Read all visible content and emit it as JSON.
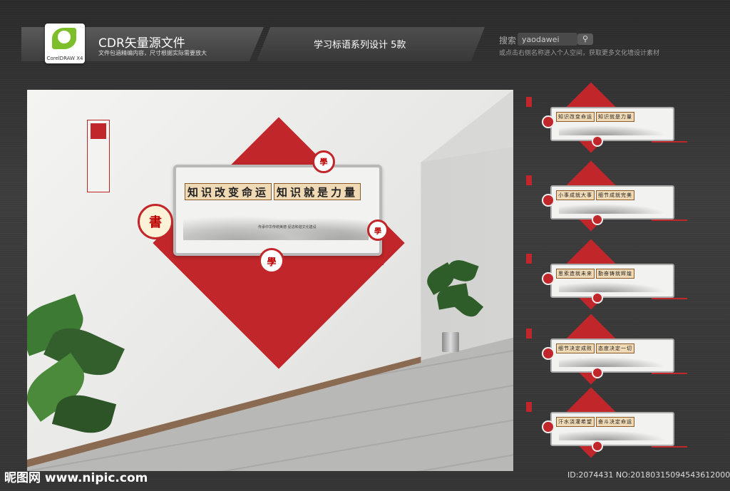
{
  "header": {
    "logo_text": "CorelDRAW X4",
    "title": "CDR矢量源文件",
    "subtitle": "文件包涵精编内容，尺寸根据实际需要放大",
    "series_title": "学习标语系列设计   5款",
    "search_label": "搜索",
    "search_value": "yaodawei",
    "search_icon": "magnifier-icon",
    "hint": "或点击右侧名称进入个人空间，获取更多文化墙设计素材"
  },
  "scene": {
    "slogan_left": "知识改变命运",
    "slogan_right": "知识就是力量",
    "banner_small_text": "传承中华传统美德  促进和谐文化建设",
    "seal_main": "書",
    "seal_small": "學"
  },
  "thumbnails": [
    {
      "left": "知识改变命运",
      "right": "知识就是力量"
    },
    {
      "left": "小事成就大事",
      "right": "细节成就完美"
    },
    {
      "left": "思索造就未来",
      "right": "勤奋铸就辉煌"
    },
    {
      "left": "细节决定成败",
      "right": "态度决定一切"
    },
    {
      "left": "汗水浇灌希望",
      "right": "奋斗决定命运"
    }
  ],
  "footer": {
    "watermark": "昵图网 www.nipic.com",
    "id_text": "ID:2074431 NO:20180315094543612000"
  },
  "colors": {
    "accent_red": "#c0262a",
    "panel_bg": "#3a3a3a"
  }
}
